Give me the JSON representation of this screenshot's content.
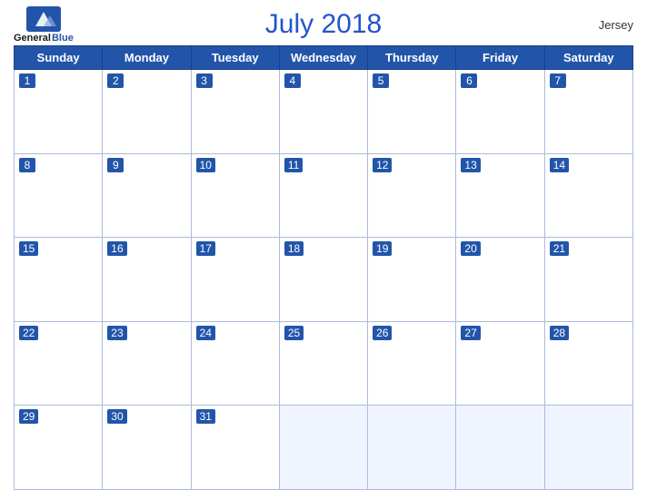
{
  "header": {
    "logo_general": "General",
    "logo_blue": "Blue",
    "title": "July 2018",
    "location": "Jersey"
  },
  "weekdays": [
    "Sunday",
    "Monday",
    "Tuesday",
    "Wednesday",
    "Thursday",
    "Friday",
    "Saturday"
  ],
  "weeks": [
    [
      1,
      2,
      3,
      4,
      5,
      6,
      7
    ],
    [
      8,
      9,
      10,
      11,
      12,
      13,
      14
    ],
    [
      15,
      16,
      17,
      18,
      19,
      20,
      21
    ],
    [
      22,
      23,
      24,
      25,
      26,
      27,
      28
    ],
    [
      29,
      30,
      31,
      null,
      null,
      null,
      null
    ]
  ]
}
